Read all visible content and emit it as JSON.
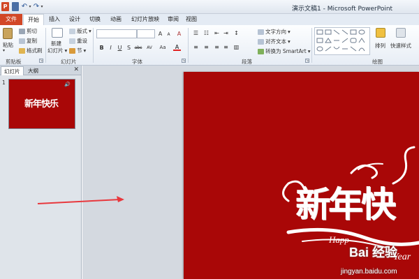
{
  "titlebar": {
    "app_icon": "P",
    "doc_title": "演示文稿1 - Microsoft PowerPoint",
    "undo_icon": "↶",
    "redo_icon": "↷",
    "dropdown_icon": "▾"
  },
  "tabs": {
    "file": "文件",
    "home": "开始",
    "insert": "插入",
    "design": "设计",
    "transitions": "切换",
    "animations": "动画",
    "slideshow": "幻灯片放映",
    "review": "审阅",
    "view": "视图"
  },
  "ribbon": {
    "clipboard": {
      "paste": "粘贴",
      "cut": "剪切",
      "copy": "复制",
      "format_painter": "格式刷",
      "label": "剪贴板"
    },
    "slides": {
      "new_slide_line1": "新建",
      "new_slide_line2": "幻灯片",
      "layout": "版式",
      "reset": "重设",
      "section": "节",
      "label": "幻灯片"
    },
    "font": {
      "font_name": "",
      "font_size": "",
      "grow": "A",
      "shrink": "A",
      "clear": "A",
      "bold": "B",
      "italic": "I",
      "underline": "U",
      "strike": "S",
      "shadow": "abc",
      "spacing": "AV",
      "case": "Aa",
      "color": "A",
      "label": "字体"
    },
    "paragraph": {
      "text_direction": "文字方向",
      "align_text": "对齐文本",
      "convert_smartart": "转换为 SmartArt",
      "label": "段落"
    },
    "drawing": {
      "arrange": "排列",
      "quick_styles": "快速样式",
      "label": "绘图"
    }
  },
  "panel": {
    "tab_slides": "幻灯片",
    "tab_outline": "大纲",
    "close": "✕",
    "thumb_number": "1",
    "thumb_title": "新年快乐"
  },
  "slide": {
    "title": "新年快",
    "happy": "Happ",
    "year": "Year"
  },
  "watermark": {
    "logo": "Bai 经验",
    "url": "jingyan.baidu.com"
  },
  "colors": {
    "file_tab": "#d24726",
    "slide_bg": "#a90707",
    "arrow": "#e8383d"
  }
}
